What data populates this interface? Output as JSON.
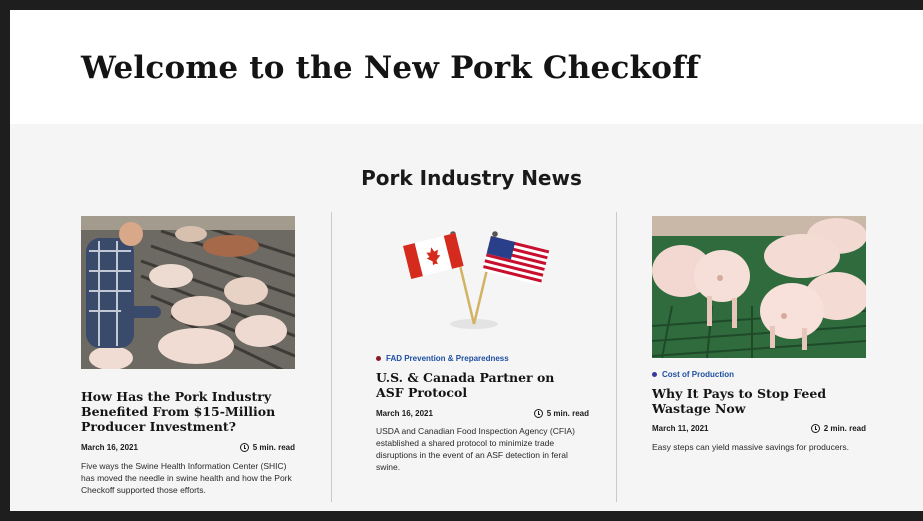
{
  "hero": {
    "title": "Welcome to the New Pork Checkoff"
  },
  "news": {
    "heading": "Pork Industry News",
    "articles": [
      {
        "image": "farmer-with-pigs-photo",
        "category": "",
        "title": "How Has the Pork Industry Benefited From $15-Million Producer Investment?",
        "date": "March 16, 2021",
        "read_time": "5 min. read",
        "description": "Five ways the Swine Health Information Center (SHIC) has moved the needle in swine health and how the Pork Checkoff supported those efforts."
      },
      {
        "image": "canada-us-flags-illustration",
        "category": "FAD Prevention & Preparedness",
        "category_color": "#1f4fa3",
        "dot_color": "#8a1a2a",
        "title": "U.S. & Canada Partner on ASF Protocol",
        "date": "March 16, 2021",
        "read_time": "5 min. read",
        "description": "USDA and Canadian Food Inspection Agency (CFIA) established a shared protocol to minimize trade disruptions in the event of an ASF detection in feral swine."
      },
      {
        "image": "piglets-on-green-floor-photo",
        "category": "Cost of Production",
        "category_color": "#1f4fa3",
        "dot_color": "#3a3a9a",
        "title": "Why It Pays to Stop Feed Wastage Now",
        "date": "March 11, 2021",
        "read_time": "2 min. read",
        "description": "Easy steps can yield massive savings for producers."
      }
    ]
  }
}
